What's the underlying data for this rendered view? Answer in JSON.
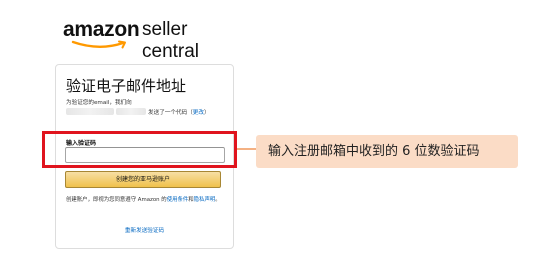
{
  "logo": {
    "amazon": "amazon",
    "seller_central": "seller central"
  },
  "card": {
    "title": "验证电子邮件地址",
    "intro_prefix": "为验证您的email，我们向",
    "intro_suffix": "发送了一个代码（",
    "change_link": "更改",
    "intro_end": "）",
    "code_label": "输入验证码",
    "code_value": "",
    "submit_label": "创建您的亚马逊账户",
    "legal_prefix": "创建账户，即视为您同意遵守 Amazon 的",
    "terms_link": "使用条件",
    "legal_and": "和",
    "privacy_link": "隐私声明",
    "legal_end": "。",
    "resend_link": "重新发送验证码"
  },
  "annotation": {
    "callout_text": "输入注册邮箱中收到的 6 位数验证码"
  },
  "colors": {
    "highlight_border": "#e0141e",
    "callout_bg": "#fbdcc6",
    "link": "#0066c0",
    "button": "#f0c14b"
  }
}
